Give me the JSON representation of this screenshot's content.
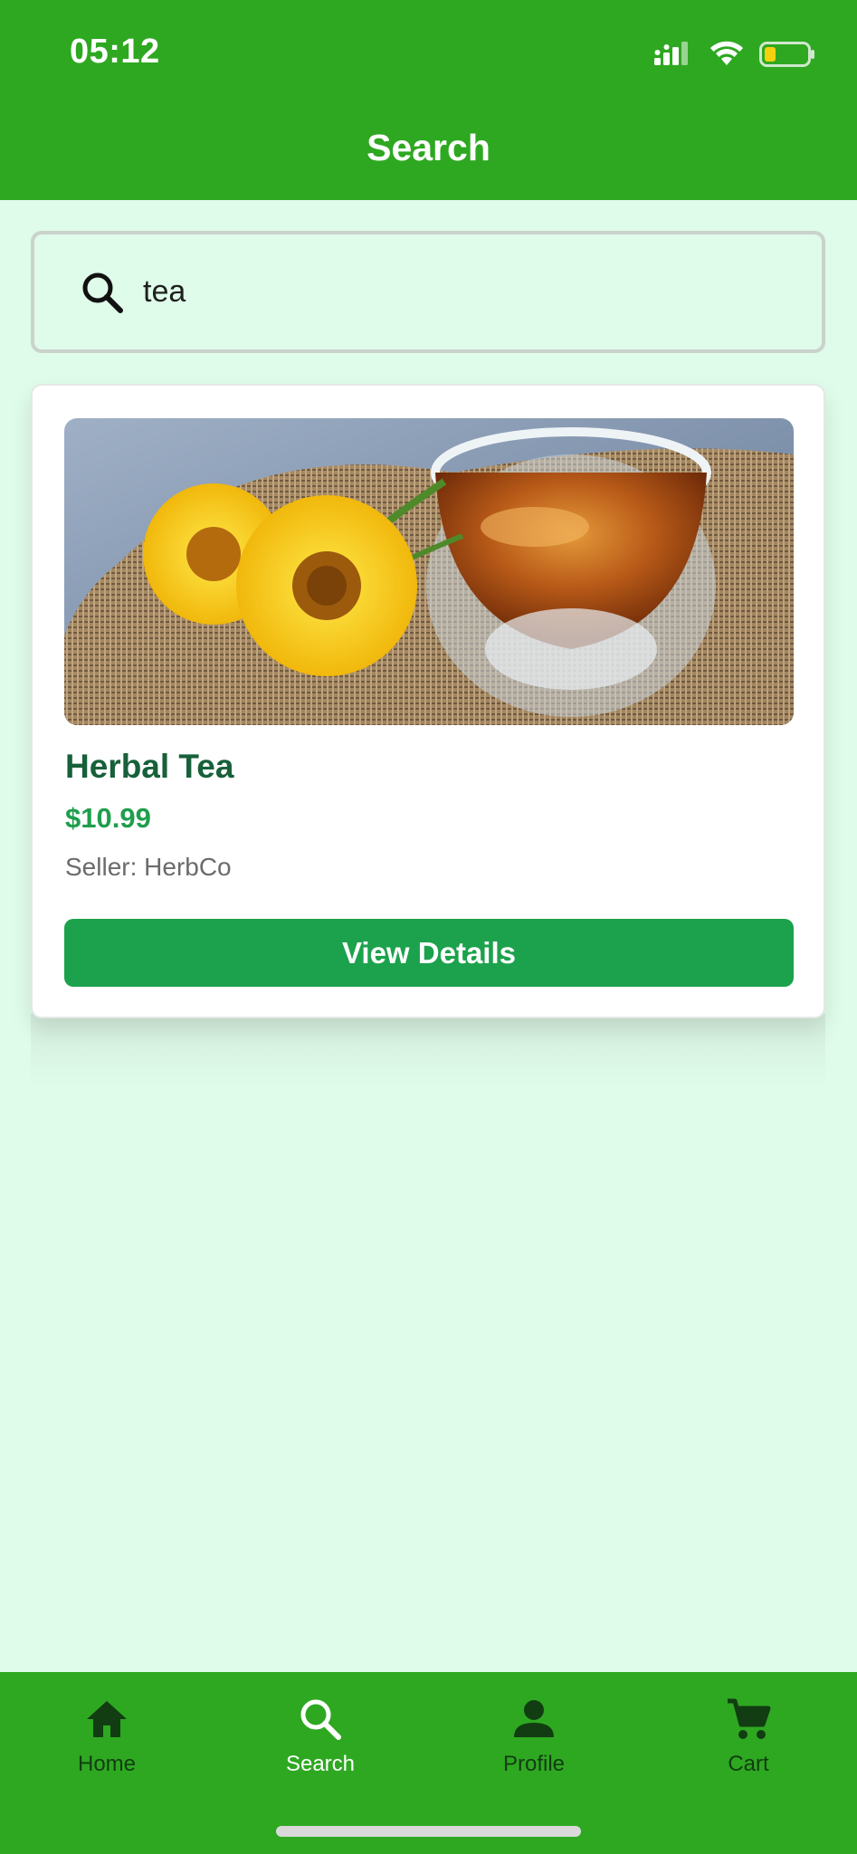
{
  "status_bar": {
    "time": "05:12",
    "icons": [
      "signal-icon",
      "wifi-icon",
      "battery-icon"
    ],
    "battery_level": 0.25,
    "battery_color": "#f5d00f"
  },
  "header": {
    "title": "Search",
    "background": "#2ea821"
  },
  "search": {
    "icon": "search-icon",
    "value": "tea"
  },
  "results": [
    {
      "image_alt": "herbal-tea-image",
      "name": "Herbal Tea",
      "price": "$10.99",
      "seller": "Seller: HerbCo",
      "button_label": "View Details"
    }
  ],
  "bottom_nav": {
    "items": [
      {
        "icon": "home-icon",
        "label": "Home",
        "active": false
      },
      {
        "icon": "search-icon",
        "label": "Search",
        "active": true
      },
      {
        "icon": "profile-icon",
        "label": "Profile",
        "active": false
      },
      {
        "icon": "cart-icon",
        "label": "Cart",
        "active": false
      }
    ]
  },
  "colors": {
    "page_background": "#dffbe9",
    "accent_green": "#1ca24c",
    "title_green": "#17603a",
    "nav_inactive": "#123d12"
  }
}
